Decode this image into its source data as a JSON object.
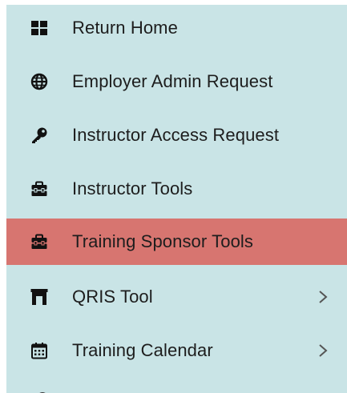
{
  "menu": {
    "items": [
      {
        "label": "Return Home",
        "icon": "grid-icon"
      },
      {
        "label": "Employer Admin Request",
        "icon": "globe-icon"
      },
      {
        "label": "Instructor Access Request",
        "icon": "key-icon"
      },
      {
        "label": "Instructor Tools",
        "icon": "toolbox-icon"
      },
      {
        "label": "Training Sponsor Tools",
        "icon": "toolbox-icon",
        "active": true
      },
      {
        "label": "QRIS Tool",
        "icon": "archway-icon",
        "has_submenu": true
      },
      {
        "label": "Training Calendar",
        "icon": "calendar-icon",
        "has_submenu": true
      }
    ]
  },
  "colors": {
    "sidebar_bg": "#c9e4e6",
    "active_bg": "#d77570",
    "text": "#1d1d1d",
    "icon": "#111111",
    "chevron": "#555555"
  }
}
